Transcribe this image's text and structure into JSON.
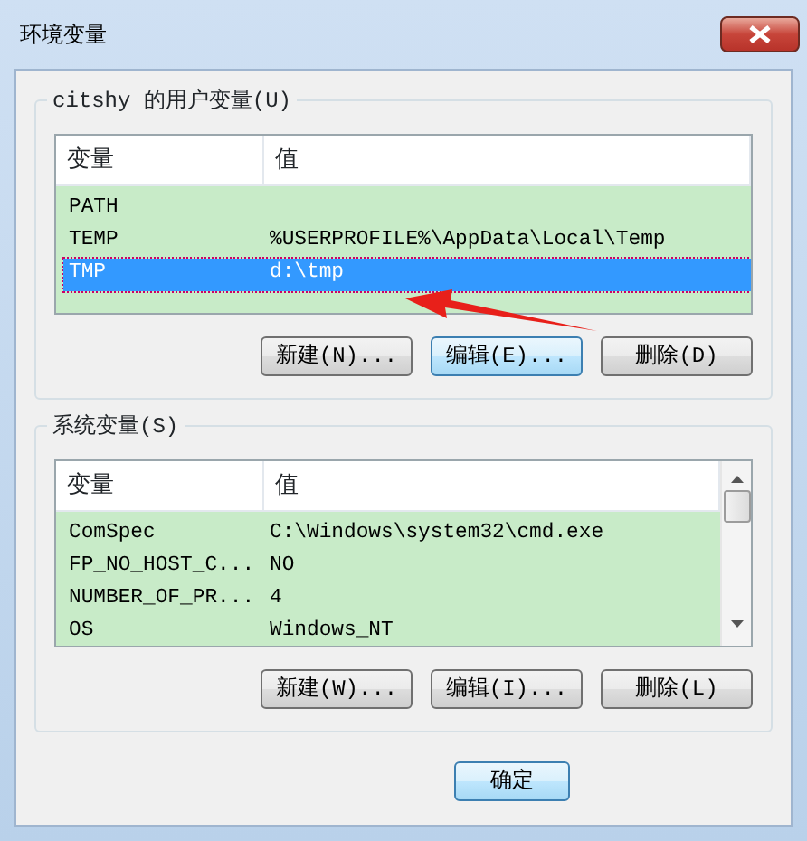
{
  "window": {
    "title": "环境变量"
  },
  "user_vars": {
    "label": "citshy 的用户变量(U)",
    "columns": [
      "变量",
      "值"
    ],
    "rows": [
      {
        "name": "PATH",
        "value": "",
        "selected": false
      },
      {
        "name": "TEMP",
        "value": "%USERPROFILE%\\AppData\\Local\\Temp",
        "selected": false
      },
      {
        "name": "TMP",
        "value": "d:\\tmp",
        "selected": true
      }
    ],
    "buttons": [
      {
        "label": "新建(N)...",
        "focused": false
      },
      {
        "label": "编辑(E)...",
        "focused": true
      },
      {
        "label": "删除(D)",
        "focused": false
      }
    ]
  },
  "system_vars": {
    "label": "系统变量(S)",
    "columns": [
      "变量",
      "值"
    ],
    "rows": [
      {
        "name": "ComSpec",
        "value": "C:\\Windows\\system32\\cmd.exe",
        "selected": false
      },
      {
        "name": "FP_NO_HOST_C...",
        "value": "NO",
        "selected": false
      },
      {
        "name": "NUMBER_OF_PR...",
        "value": "4",
        "selected": false
      },
      {
        "name": "OS",
        "value": "Windows_NT",
        "selected": false
      }
    ],
    "buttons": [
      {
        "label": "新建(W)...",
        "focused": false
      },
      {
        "label": "编辑(I)...",
        "focused": false
      },
      {
        "label": "删除(L)",
        "focused": false
      }
    ]
  },
  "footer_buttons": [
    {
      "label": "确定",
      "focused": true
    }
  ]
}
